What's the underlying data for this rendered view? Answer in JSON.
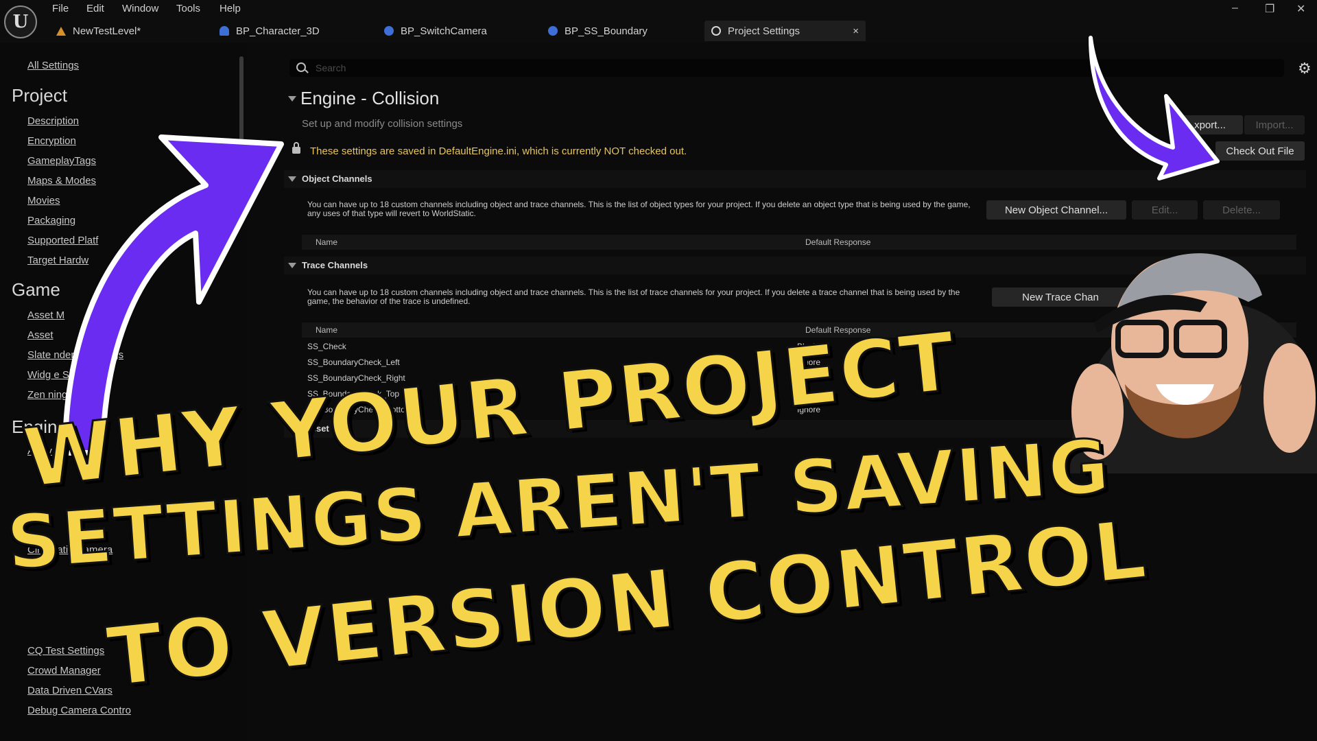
{
  "menu": {
    "items": [
      "File",
      "Edit",
      "Window",
      "Tools",
      "Help"
    ]
  },
  "tabs": [
    {
      "label": "NewTestLevel*"
    },
    {
      "label": "BP_Character_3D"
    },
    {
      "label": "BP_SwitchCamera"
    },
    {
      "label": "BP_SS_Boundary"
    },
    {
      "label": "Project Settings",
      "active": true
    }
  ],
  "sidebar": {
    "all_settings": "All Settings",
    "project_heading": "Project",
    "project_items": [
      "Description",
      "Encryption",
      "GameplayTags",
      "Maps & Modes",
      "Movies",
      "Packaging",
      "Supported Platf",
      "Target Hardw"
    ],
    "game_heading": "Game",
    "game_items": [
      "Asset M",
      "Asset",
      "Slate      nderer Settings",
      "Widg       e Settings",
      "Zen        ning"
    ],
    "engine_heading": "Engin",
    "engine_items": [
      "AI Sy",
      "Cinematic Camera",
      "CQ Test Settings",
      "Crowd Manager",
      "Data Driven CVars",
      "Debug Camera Contro"
    ]
  },
  "search": {
    "placeholder": "Search"
  },
  "section": {
    "title": "Engine - Collision",
    "subtitle": "Set up and modify collision settings",
    "export_label": "xport...",
    "import_label": "Import...",
    "warning": "These settings are saved in DefaultEngine.ini, which is currently NOT checked out.",
    "checkout_label": "Check Out File"
  },
  "object_channels": {
    "label": "Object Channels",
    "description": "You can have up to 18 custom channels including object and trace channels. This is the list of object types for your project. If you delete an object type that is being used by the game, any uses of that type will revert to WorldStatic.",
    "new_label": "New Object Channel...",
    "edit_label": "Edit...",
    "delete_label": "Delete...",
    "col_name": "Name",
    "col_response": "Default Response"
  },
  "trace_channels": {
    "label": "Trace Channels",
    "description": "You can have up to 18 custom channels including object and trace channels. This is the list of trace channels for your project. If you delete a trace channel that is being used by the game, the behavior of the trace is undefined.",
    "new_label": "New Trace Chan",
    "col_name": "Name",
    "col_response": "Default Response",
    "rows": [
      {
        "name": "SS_Check",
        "response": "Block"
      },
      {
        "name": "SS_BoundaryCheck_Left",
        "response": "Ignore"
      },
      {
        "name": "SS_BoundaryCheck_Right",
        "response": "Ignore"
      },
      {
        "name": "SS_BoundaryCheck_Top",
        "response": "Ignore"
      },
      {
        "name": "SS_BoundaryCheck_Bottom",
        "response": "Ignore"
      }
    ]
  },
  "preset": {
    "label": "Preset"
  },
  "headline": {
    "line1": "WHY YOUR PROJECT",
    "line2": "SETTINGS AREN'T SAVING",
    "line3": "TO VERSION CONTROL"
  },
  "colors": {
    "headline": "#f6d44a",
    "arrow": "#6a2cf0",
    "warning": "#e8c65a"
  }
}
